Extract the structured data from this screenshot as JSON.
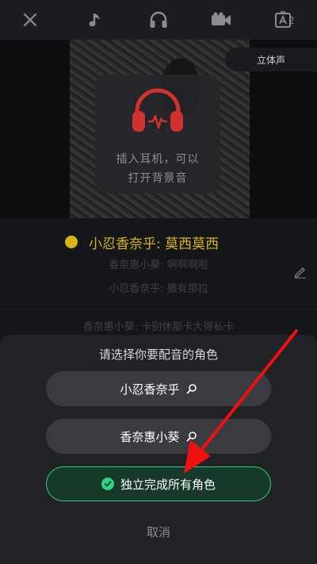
{
  "toolbar": {
    "icons": [
      "close-icon",
      "music-note-icon",
      "headphones-icon",
      "video-camera-icon",
      "subtitle-icon"
    ],
    "subtitle_badge": "2"
  },
  "video": {
    "stereo_label": "立体声",
    "earphone_hint_line1": "插入耳机，可以",
    "earphone_hint_line2": "打开背景音"
  },
  "lyrics": {
    "current": "小忍香奈乎: 莫西莫西",
    "line2": "香奈惠小葵: 啊啊啊啦",
    "line3": "小忍香奈乎: 撒有那拉",
    "line4": "香奈惠小葵: 卡别休那卡大得私卡"
  },
  "sheet": {
    "title": "请选择你要配音的角色",
    "role1": "小忍香奈乎",
    "role2": "香奈惠小葵",
    "solo": "独立完成所有角色",
    "cancel": "取消"
  },
  "colors": {
    "accent_green": "#2fd387",
    "highlight_yellow": "#d6b418",
    "annotation_red": "#ee1111"
  }
}
